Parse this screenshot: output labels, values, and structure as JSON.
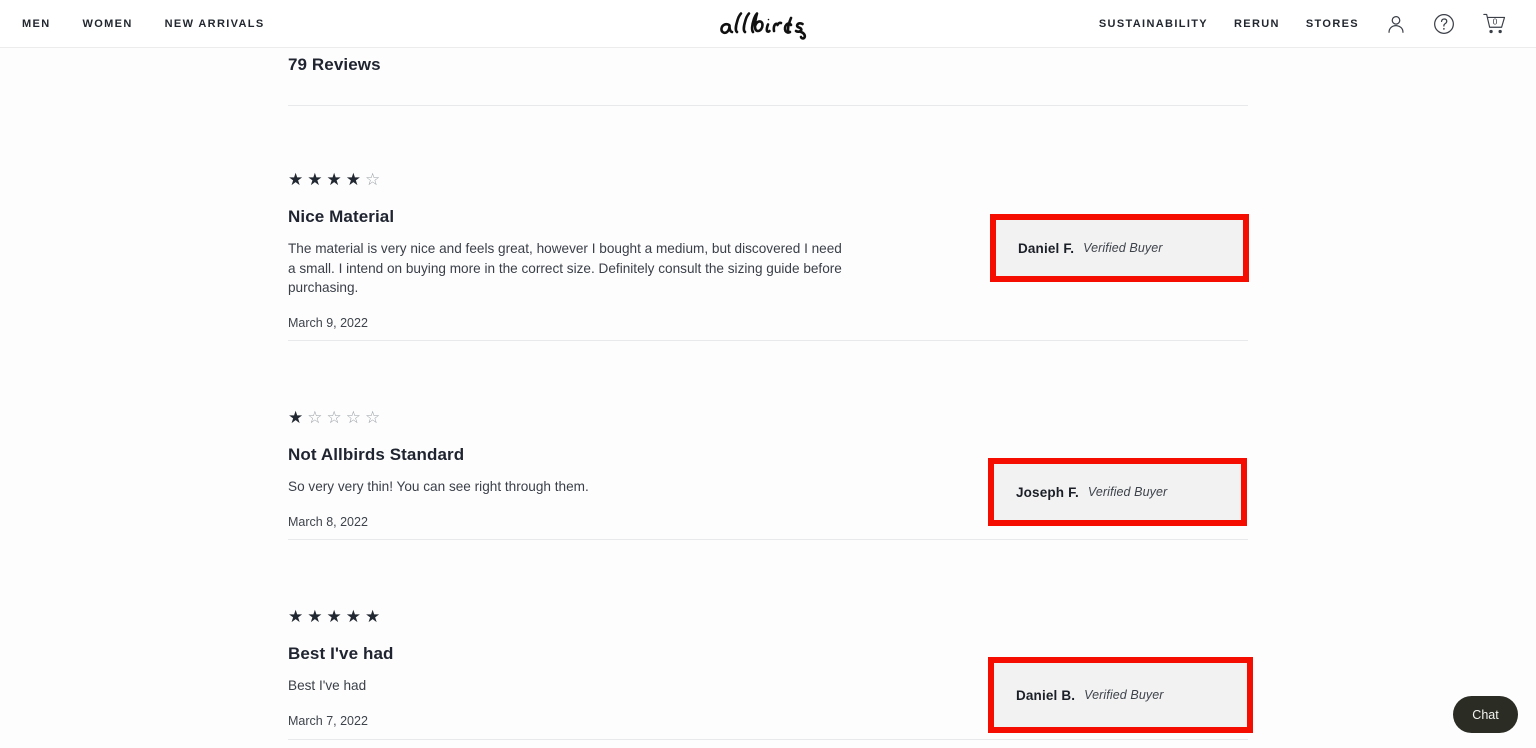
{
  "header": {
    "brand": "allbirds",
    "nav_left": [
      {
        "label": "MEN",
        "name": "nav-men"
      },
      {
        "label": "WOMEN",
        "name": "nav-women"
      },
      {
        "label": "NEW ARRIVALS",
        "name": "nav-new-arrivals"
      }
    ],
    "nav_right": [
      {
        "label": "SUSTAINABILITY",
        "name": "nav-sustainability"
      },
      {
        "label": "RERUN",
        "name": "nav-rerun"
      },
      {
        "label": "STORES",
        "name": "nav-stores"
      }
    ],
    "icons": {
      "account": "user-icon",
      "help": "question-mark-circle-icon",
      "cart": "shopping-cart-icon"
    },
    "cart_count": "0"
  },
  "reviews_section": {
    "count_label": "79 Reviews",
    "verified_label": "Verified Buyer",
    "reviews": [
      {
        "rating": 4,
        "title": "Nice Material",
        "body": "The material is very nice and feels great, however I bought a medium, but discovered I need a small. I intend on buying more in the correct size. Definitely consult the sizing guide before purchasing.",
        "date": "March 9, 2022",
        "reviewer": "Daniel F.",
        "verified": "Verified Buyer"
      },
      {
        "rating": 1,
        "title": "Not Allbirds Standard",
        "body": "So very very thin! You can see right through them.",
        "date": "March 8, 2022",
        "reviewer": "Joseph F.",
        "verified": "Verified Buyer"
      },
      {
        "rating": 5,
        "title": "Best I've had",
        "body": "Best I've had",
        "date": "March 7, 2022",
        "reviewer": "Daniel B.",
        "verified": "Verified Buyer"
      }
    ]
  },
  "chat": {
    "label": "Chat"
  },
  "colors": {
    "highlight": "#f50d02",
    "text": "#1f2430",
    "rule": "#e8e9ea",
    "box_fill": "#f2f2f2",
    "chat_bg": "#2b2d25"
  }
}
